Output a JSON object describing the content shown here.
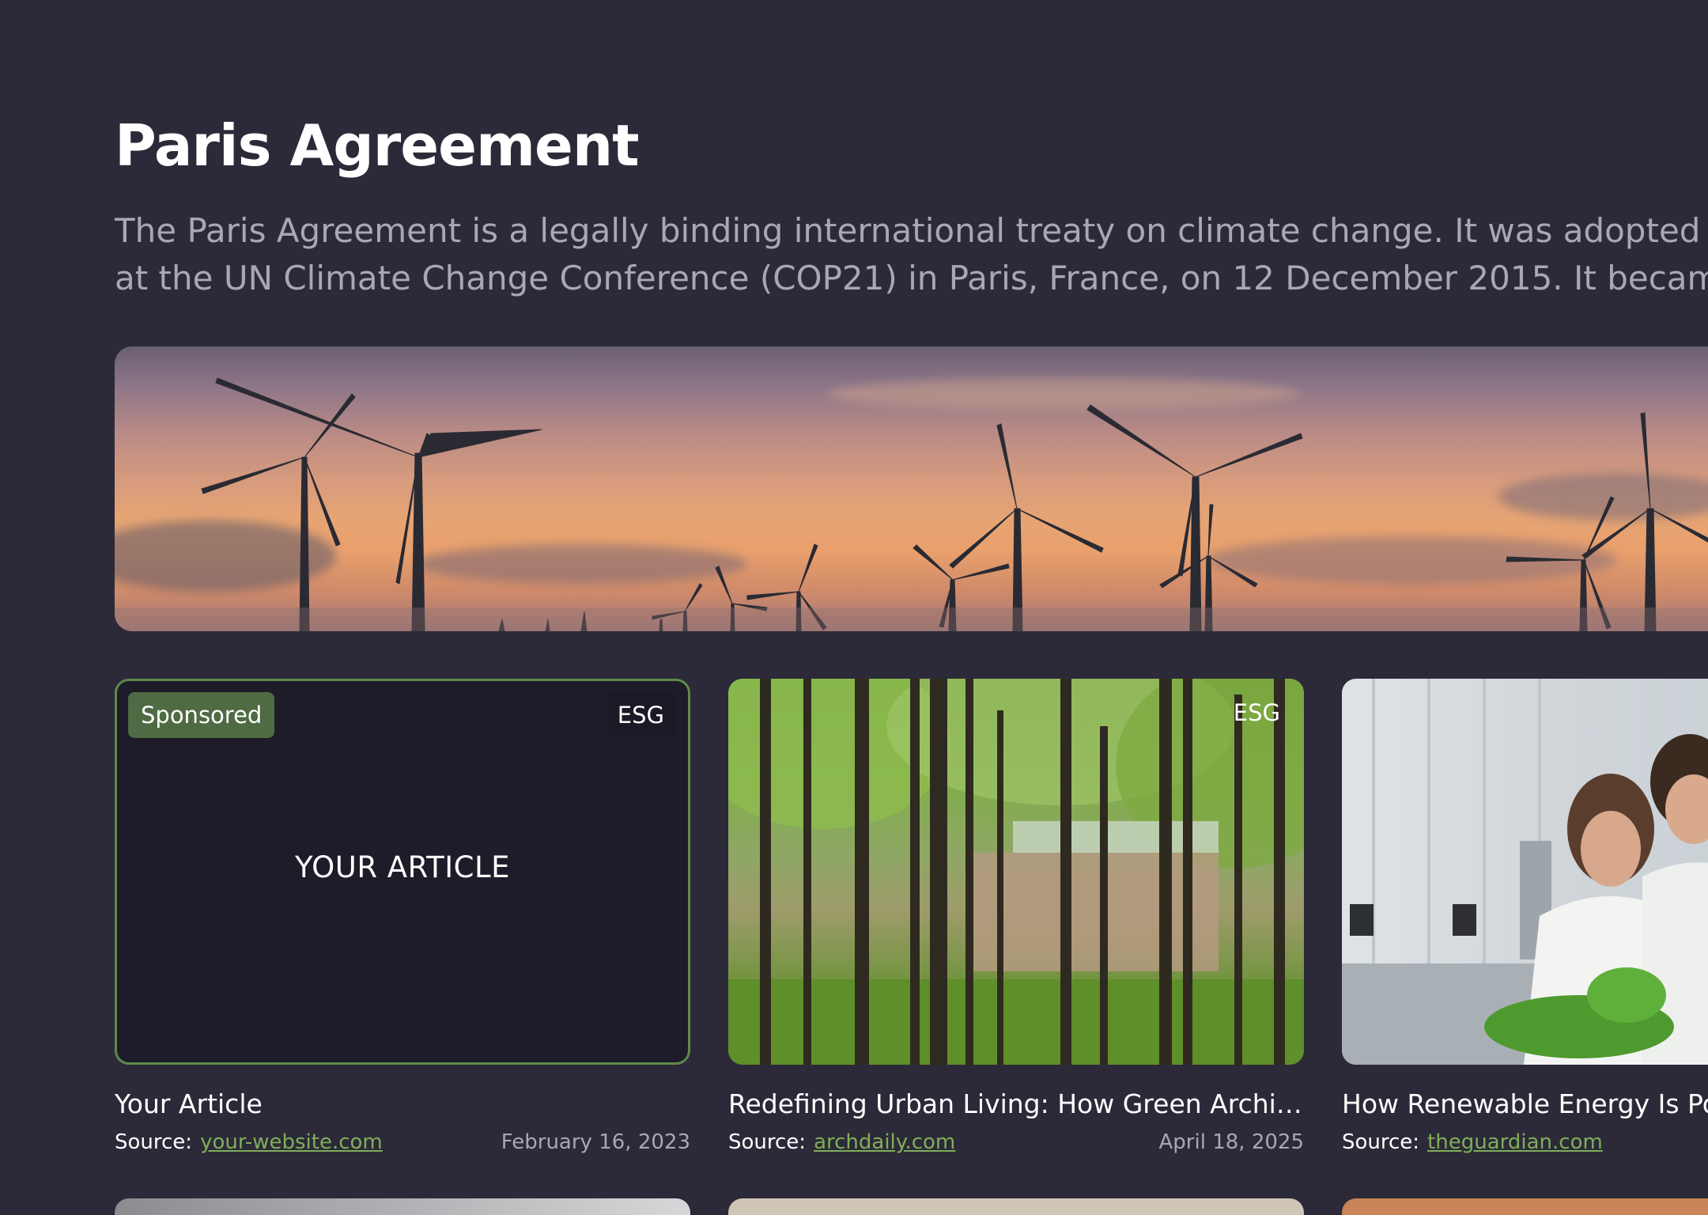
{
  "page": {
    "title": "Paris Agreement",
    "description_lines": [
      "The Paris Agreement is a legally binding international treaty on climate change. It was adopted by",
      "at the UN Climate Change Conference (COP21) in Paris, France, on 12 December 2015. It became e"
    ]
  },
  "hero": {
    "image": "wind-turbines-sunset"
  },
  "cards": [
    {
      "badge_left": "Sponsored",
      "badge_right": "ESG",
      "placeholder": "YOUR ARTICLE",
      "headline": "Your Article",
      "source_label": "Source:",
      "source_link": "your-website.com",
      "date": "February 16, 2023"
    },
    {
      "badge_right": "ESG",
      "headline": "Redefining Urban Living: How Green Archite...",
      "source_label": "Source:",
      "source_link": "archdaily.com",
      "date": "April 18, 2025"
    },
    {
      "headline": "How Renewable Energy Is Po",
      "source_label": "Source:",
      "source_link": "theguardian.com"
    }
  ],
  "colors": {
    "background": "#2c2a38",
    "accent_green": "#7fae5a",
    "sponsored_badge": "#4e6b43",
    "muted_text": "#a9a7b3"
  }
}
